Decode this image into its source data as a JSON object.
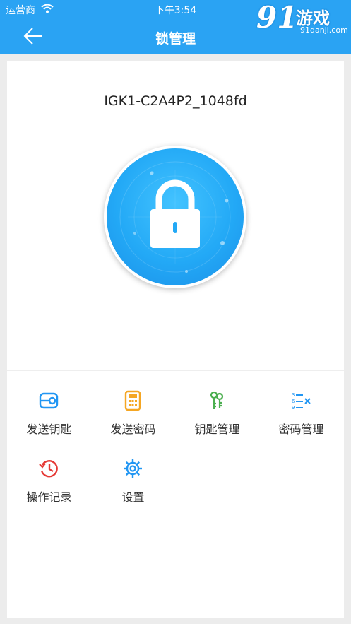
{
  "status_bar": {
    "carrier": "运营商",
    "time": "下午3:54"
  },
  "nav": {
    "title": "锁管理"
  },
  "watermark": {
    "logo_number": "91",
    "logo_text": "游戏",
    "url": "91danji.com"
  },
  "lock": {
    "device_name": "IGK1-C2A4P2_1048fd"
  },
  "menu": [
    {
      "label": "发送钥匙",
      "icon": "key-card-icon",
      "color": "#2196f3"
    },
    {
      "label": "发送密码",
      "icon": "calculator-icon",
      "color": "#f5a623"
    },
    {
      "label": "钥匙管理",
      "icon": "keys-icon",
      "color": "#4caf50"
    },
    {
      "label": "密码管理",
      "icon": "password-list-icon",
      "color": "#2196f3"
    },
    {
      "label": "操作记录",
      "icon": "history-icon",
      "color": "#e53935"
    },
    {
      "label": "设置",
      "icon": "gear-icon",
      "color": "#2196f3"
    }
  ],
  "colors": {
    "header": "#2aa3f3",
    "lock_blue": "#23a9f6",
    "background": "#ececec"
  }
}
